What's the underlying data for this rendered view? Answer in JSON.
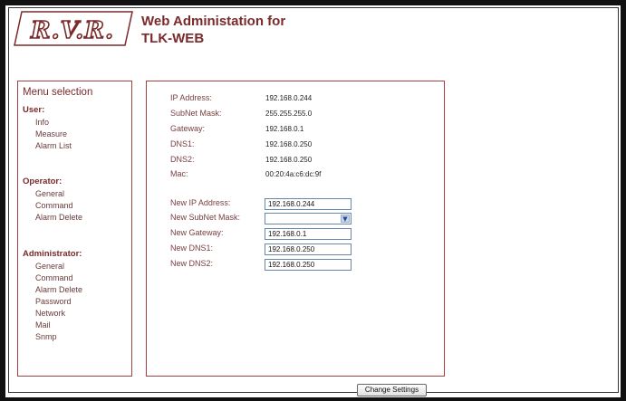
{
  "header": {
    "logo_text": "R.V.R.",
    "title_line1": "Web Administation for",
    "title_line2": "TLK-WEB"
  },
  "menu": {
    "title": "Menu selection",
    "groups": [
      {
        "title": "User:",
        "items": [
          "Info",
          "Measure",
          "Alarm List"
        ]
      },
      {
        "title": "Operator:",
        "items": [
          "General",
          "Command",
          "Alarm Delete"
        ]
      },
      {
        "title": "Administrator:",
        "items": [
          "General",
          "Command",
          "Alarm Delete",
          "Password",
          "Network",
          "Mail",
          "Snmp"
        ]
      }
    ]
  },
  "network_info": [
    {
      "label": "IP Address:",
      "value": "192.168.0.244"
    },
    {
      "label": "SubNet Mask:",
      "value": "255.255.255.0"
    },
    {
      "label": "Gateway:",
      "value": "192.168.0.1"
    },
    {
      "label": "DNS1:",
      "value": "192.168.0.250"
    },
    {
      "label": "DNS2:",
      "value": "192.168.0.250"
    },
    {
      "label": "Mac:",
      "value": "00:20:4a:c6:dc:9f"
    }
  ],
  "settings_form": {
    "new_ip": {
      "label": "New IP Address:",
      "value": "192.168.0.244"
    },
    "new_subnet": {
      "label": "New SubNet Mask:",
      "value": ""
    },
    "new_gateway": {
      "label": "New Gateway:",
      "value": "192.168.0.1"
    },
    "new_dns1": {
      "label": "New DNS1:",
      "value": "192.168.0.250"
    },
    "new_dns2": {
      "label": "New DNS2:",
      "value": "192.168.0.250"
    }
  },
  "change_settings_label": "Change Settings",
  "colors": {
    "accent": "#7a2a2a",
    "panel_border": "#a34040",
    "frame": "#111111"
  }
}
